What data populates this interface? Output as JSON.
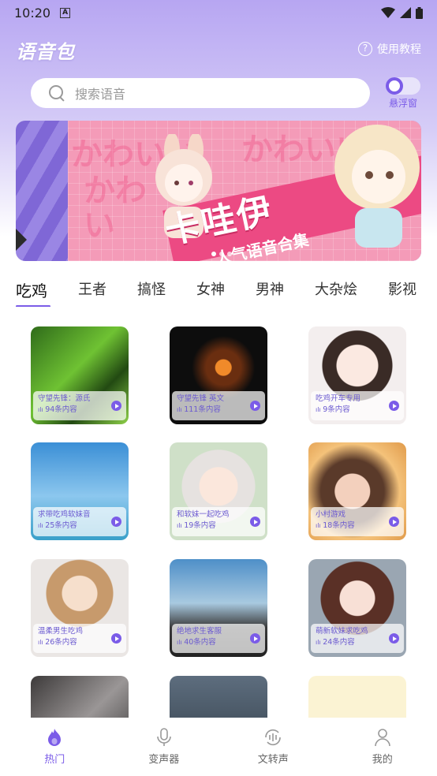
{
  "status_bar": {
    "time": "10:20",
    "notification_letter": "A"
  },
  "header": {
    "title": "语音包",
    "tutorial_label": "使用教程",
    "tutorial_icon": "question-circle-icon"
  },
  "search": {
    "placeholder": "搜索语音"
  },
  "float_window": {
    "label": "悬浮窗",
    "enabled": true
  },
  "banner": {
    "title": "卡哇伊",
    "subtitle": "人气语音合集",
    "deco_text": [
      "かわいい",
      "かわいい",
      "かわ",
      "い"
    ]
  },
  "tabs": [
    {
      "label": "吃鸡",
      "active": true
    },
    {
      "label": "王者"
    },
    {
      "label": "搞怪"
    },
    {
      "label": "女神"
    },
    {
      "label": "男神"
    },
    {
      "label": "大杂烩"
    },
    {
      "label": "影视"
    }
  ],
  "cards": [
    {
      "title": "守望先锋：源氏",
      "count": "94条内容"
    },
    {
      "title": "守望先锋 英文",
      "count": "111条内容"
    },
    {
      "title": "吃鸡开车专用",
      "count": "9条内容"
    },
    {
      "title": "求带吃鸡软妹音",
      "count": "25条内容"
    },
    {
      "title": "和软妹一起吃鸡",
      "count": "19条内容"
    },
    {
      "title": "小村游戏",
      "count": "18条内容"
    },
    {
      "title": "温柔男生吃鸡",
      "count": "26条内容"
    },
    {
      "title": "绝地求生客服",
      "count": "40条内容"
    },
    {
      "title": "萌新软妹求吃鸡",
      "count": "24条内容"
    }
  ],
  "bottom_nav": [
    {
      "label": "热门",
      "icon": "fire-icon",
      "active": true
    },
    {
      "label": "变声器",
      "icon": "microphone-icon"
    },
    {
      "label": "文转声",
      "icon": "text-to-speech-icon"
    },
    {
      "label": "我的",
      "icon": "person-icon"
    }
  ],
  "colors": {
    "accent": "#7b5ce8",
    "hero_top": "#b7a6f2",
    "banner_pink": "#f49bb8"
  }
}
